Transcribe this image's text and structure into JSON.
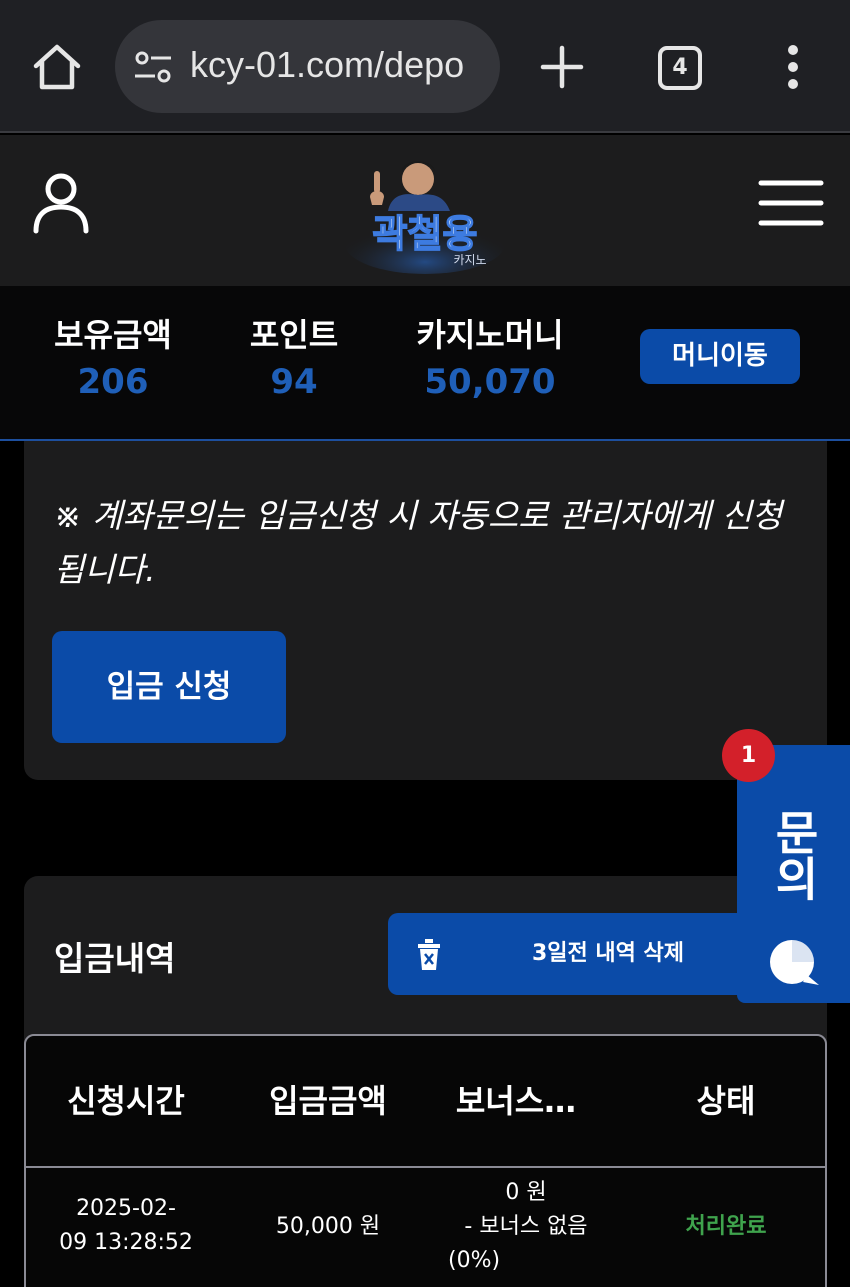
{
  "browser": {
    "url": "kcy-01.com/depo",
    "tab_count": "4"
  },
  "balance": {
    "holdings_label": "보유금액",
    "holdings_value": "206",
    "points_label": "포인트",
    "points_value": "94",
    "casino_money_label": "카지노머니",
    "casino_money_value": "50,070",
    "money_move_label": "머니이동"
  },
  "deposit": {
    "notice": "※ 계좌문의는 입금신청 시 자동으로 관리자에게 신청됩니다.",
    "request_button": "입금 신청"
  },
  "history": {
    "title": "입금내역",
    "delete_button": "3일전 내역 삭제",
    "columns": [
      "신청시간",
      "입금금액",
      "보너스…",
      "상태"
    ],
    "rows": [
      {
        "time_line1": "2025-02-",
        "time_line2": "09 13:28:52",
        "amount": "50,000 원",
        "bonus_line1": "0 원",
        "bonus_line2": "- 보너스 없음",
        "bonus_line3": "(0%)",
        "status": "처리완료"
      }
    ]
  },
  "inquiry": {
    "label": "문의",
    "badge": "1"
  },
  "colors": {
    "accent": "#0b4ba8",
    "value_blue": "#1f5fb8",
    "status_green": "#3fa34d",
    "badge_red": "#d3202a"
  }
}
